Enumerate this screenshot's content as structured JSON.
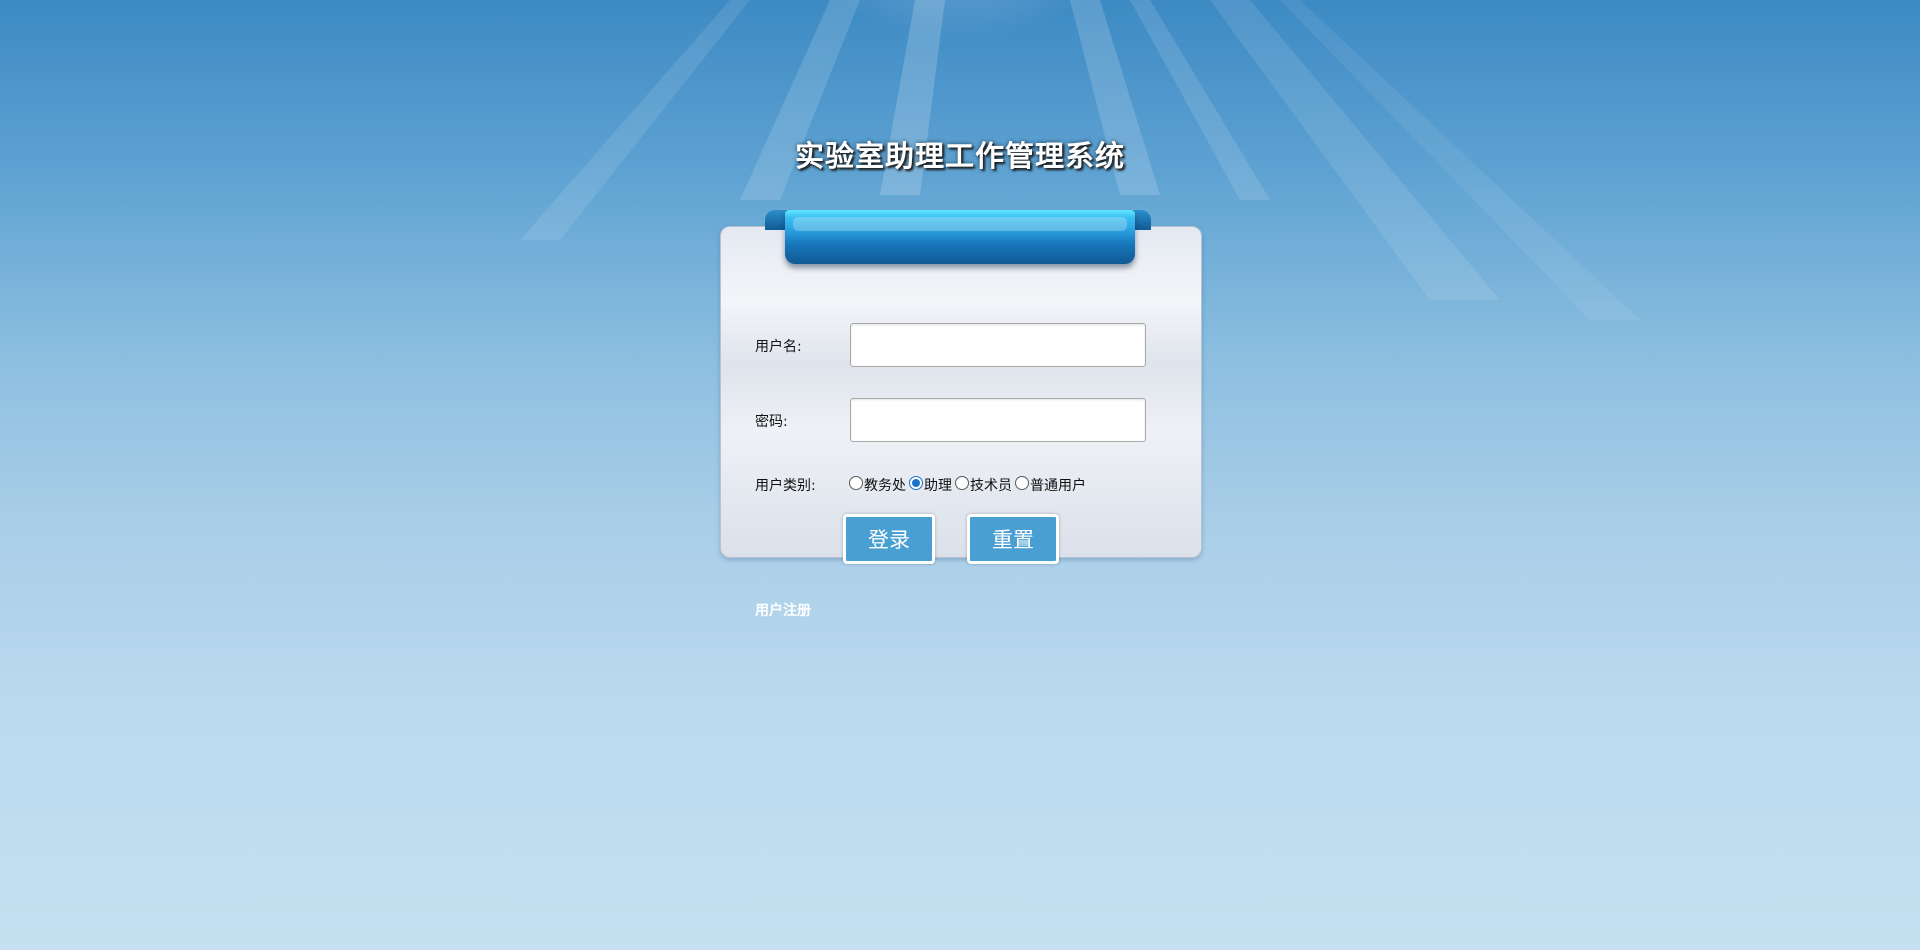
{
  "header": {
    "title": "实验室助理工作管理系统"
  },
  "form": {
    "username_label": "用户名:",
    "username_value": "",
    "password_label": "密码:",
    "password_value": "",
    "user_type_label": "用户类别:",
    "user_types": [
      {
        "label": "教务处",
        "checked": false
      },
      {
        "label": "助理",
        "checked": true
      },
      {
        "label": "技术员",
        "checked": false
      },
      {
        "label": "普通用户",
        "checked": false
      }
    ],
    "login_button": "登录",
    "reset_button": "重置"
  },
  "footer": {
    "register_link": "用户注册"
  },
  "colors": {
    "background_top": "#3d8ac4",
    "background_bottom": "#c4e0f1",
    "ribbon": "#2aa3e0",
    "button": "#4a9fd2",
    "radio_checked": "#1a73c9"
  }
}
